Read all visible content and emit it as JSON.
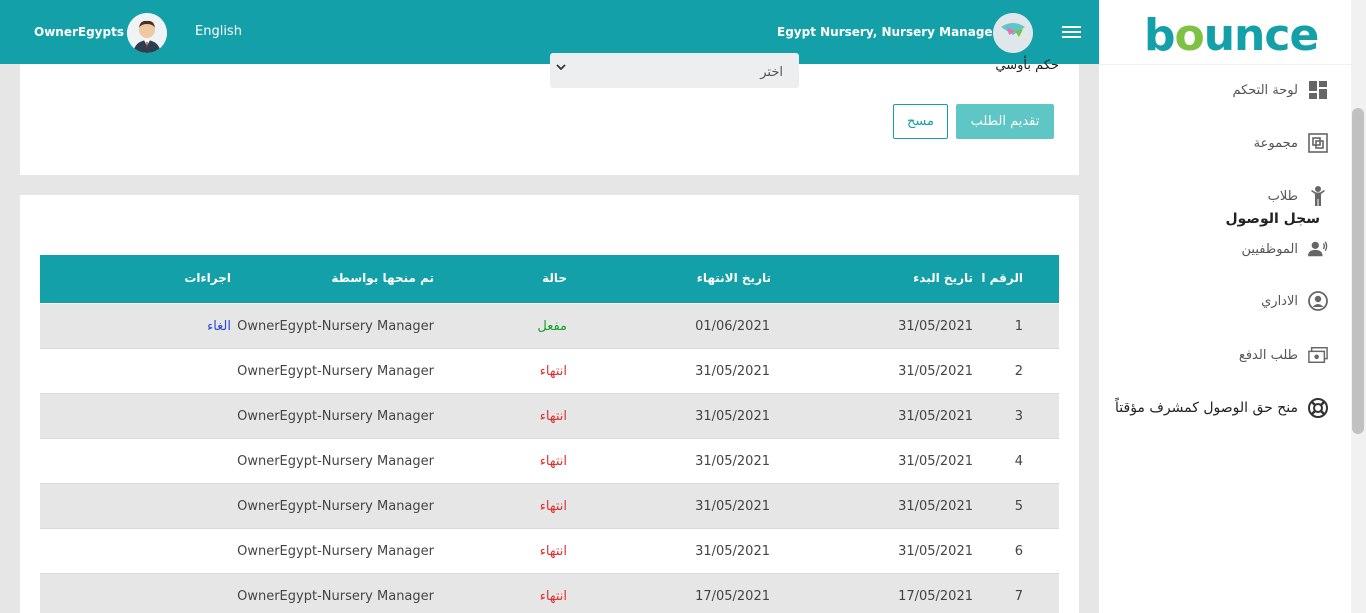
{
  "topbar": {
    "user_name": "OwnerEgypts",
    "language": "English",
    "org_label": "Egypt Nursery, Nursery Manager"
  },
  "brand": {
    "logo_pre": "b",
    "logo_o": "o",
    "logo_post": "unce"
  },
  "sidebar": {
    "items": [
      {
        "label": "لوحة التحكم",
        "icon": "dashboard-icon"
      },
      {
        "label": "مجموعة",
        "icon": "group-icon"
      },
      {
        "label": "طلاب",
        "icon": "student-icon"
      },
      {
        "label": "الموظفيين",
        "icon": "staff-icon"
      },
      {
        "label": "الاداري",
        "icon": "admin-icon"
      },
      {
        "label": "طلب الدفع",
        "icon": "payment-icon"
      },
      {
        "label": "منح حق الوصول كمشرف مؤقتاً",
        "icon": "lifebuoy-icon"
      }
    ]
  },
  "filter": {
    "label": "حكم بأوسي",
    "select_value": "اختر",
    "submit_label": "تقديم الطلب",
    "clear_label": "مسح"
  },
  "table": {
    "title": "سجل الوصول",
    "headers": {
      "num": "الرقم ا",
      "start": "تاريخ البدء",
      "end": "تاريخ الانتهاء",
      "status": "حالة",
      "by": "تم منحها بواسطة",
      "actions": "اجراءات"
    },
    "rows": [
      {
        "num": "1",
        "start": "31/05/2021",
        "end": "01/06/2021",
        "status": "مفعل",
        "by": "OwnerEgypt-Nursery Manager",
        "action": "الغاء"
      },
      {
        "num": "2",
        "start": "31/05/2021",
        "end": "31/05/2021",
        "status": "انتهاء",
        "by": "OwnerEgypt-Nursery Manager",
        "action": ""
      },
      {
        "num": "3",
        "start": "31/05/2021",
        "end": "31/05/2021",
        "status": "انتهاء",
        "by": "OwnerEgypt-Nursery Manager",
        "action": ""
      },
      {
        "num": "4",
        "start": "31/05/2021",
        "end": "31/05/2021",
        "status": "انتهاء",
        "by": "OwnerEgypt-Nursery Manager",
        "action": ""
      },
      {
        "num": "5",
        "start": "31/05/2021",
        "end": "31/05/2021",
        "status": "انتهاء",
        "by": "OwnerEgypt-Nursery Manager",
        "action": ""
      },
      {
        "num": "6",
        "start": "31/05/2021",
        "end": "31/05/2021",
        "status": "انتهاء",
        "by": "OwnerEgypt-Nursery Manager",
        "action": ""
      },
      {
        "num": "7",
        "start": "17/05/2021",
        "end": "17/05/2021",
        "status": "انتهاء",
        "by": "OwnerEgypt-Nursery Manager",
        "action": ""
      }
    ]
  },
  "colors": {
    "primary": "#14a0a8",
    "active": "#1aa12b",
    "ended": "#e03131",
    "link": "#2a4bd7"
  }
}
